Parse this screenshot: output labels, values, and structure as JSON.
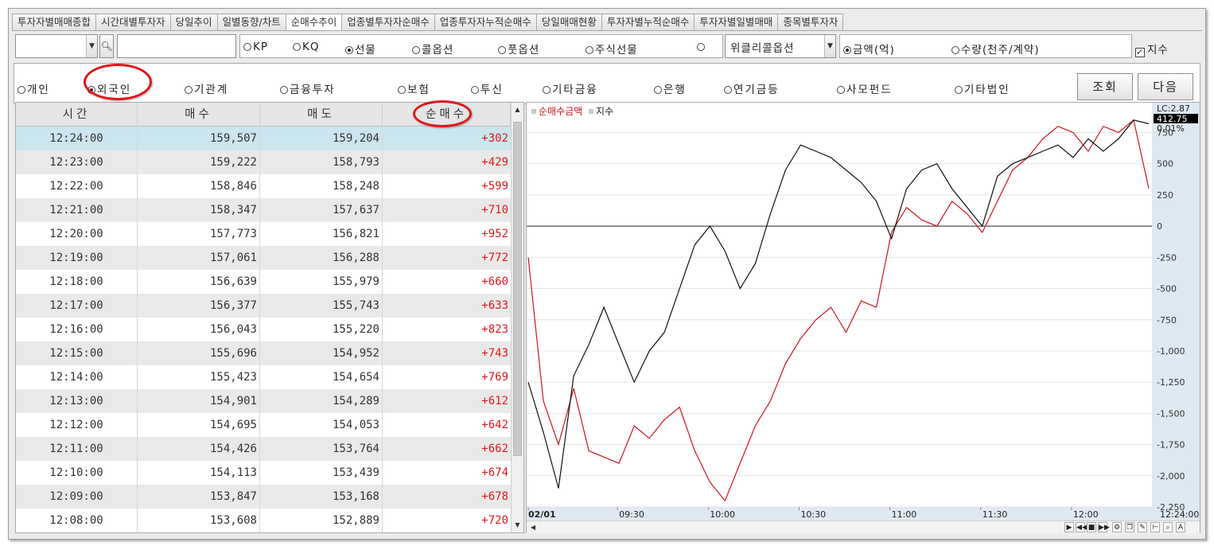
{
  "tabs": [
    "투자자별매매종합",
    "시간대별투자자",
    "당일추이",
    "일별동향/차트",
    "순매수추이",
    "업종별투자자순매수",
    "업종투자자누적순매수",
    "당일매매현황",
    "투자자별누적순매수",
    "투자자별일별매매",
    "종목별투자자"
  ],
  "active_tab": 4,
  "row1": {
    "markets": [
      {
        "label": "KP",
        "selected": false
      },
      {
        "label": "KQ",
        "selected": false
      },
      {
        "label": "선물",
        "selected": true
      },
      {
        "label": "콜옵션",
        "selected": false
      },
      {
        "label": "풋옵션",
        "selected": false
      },
      {
        "label": "주식선물",
        "selected": false
      },
      {
        "label": "",
        "selected": false
      }
    ],
    "weekly_option": "위클리콜옵션",
    "units": [
      {
        "label": "금액(억)",
        "selected": true
      },
      {
        "label": "수량(천주/계약)",
        "selected": false
      }
    ],
    "index_checkbox": {
      "label": "지수",
      "checked": true
    }
  },
  "investors": [
    {
      "label": "개인",
      "selected": false
    },
    {
      "label": "외국인",
      "selected": true
    },
    {
      "label": "기관계",
      "selected": false
    },
    {
      "label": "금융투자",
      "selected": false
    },
    {
      "label": "보험",
      "selected": false
    },
    {
      "label": "투신",
      "selected": false
    },
    {
      "label": "기타금융",
      "selected": false
    },
    {
      "label": "은행",
      "selected": false
    },
    {
      "label": "연기금등",
      "selected": false
    },
    {
      "label": "사모펀드",
      "selected": false
    },
    {
      "label": "기타법인",
      "selected": false
    }
  ],
  "buttons": {
    "query": "조회",
    "next": "다음"
  },
  "table": {
    "headers": [
      "시간",
      "매수",
      "매도",
      "순매수"
    ],
    "rows": [
      [
        "12:24:00",
        "159,507",
        "159,204",
        "+302"
      ],
      [
        "12:23:00",
        "159,222",
        "158,793",
        "+429"
      ],
      [
        "12:22:00",
        "158,846",
        "158,248",
        "+599"
      ],
      [
        "12:21:00",
        "158,347",
        "157,637",
        "+710"
      ],
      [
        "12:20:00",
        "157,773",
        "156,821",
        "+952"
      ],
      [
        "12:19:00",
        "157,061",
        "156,288",
        "+772"
      ],
      [
        "12:18:00",
        "156,639",
        "155,979",
        "+660"
      ],
      [
        "12:17:00",
        "156,377",
        "155,743",
        "+633"
      ],
      [
        "12:16:00",
        "156,043",
        "155,220",
        "+823"
      ],
      [
        "12:15:00",
        "155,696",
        "154,952",
        "+743"
      ],
      [
        "12:14:00",
        "155,423",
        "154,654",
        "+769"
      ],
      [
        "12:13:00",
        "154,901",
        "154,289",
        "+612"
      ],
      [
        "12:12:00",
        "154,695",
        "154,053",
        "+642"
      ],
      [
        "12:11:00",
        "154,426",
        "153,764",
        "+662"
      ],
      [
        "12:10:00",
        "154,113",
        "153,439",
        "+674"
      ],
      [
        "12:09:00",
        "153,847",
        "153,168",
        "+678"
      ],
      [
        "12:08:00",
        "153,608",
        "152,889",
        "+720"
      ]
    ]
  },
  "chart": {
    "legend": [
      "순매수금액",
      "지수"
    ],
    "lc_label": "LC:2.87",
    "index_value": "412.75",
    "pct_label": "0.01%",
    "y_ticks": [
      "750",
      "500",
      "250",
      "0",
      "-250",
      "-500",
      "-750",
      "-1,000",
      "-1,250",
      "-1,500",
      "-1,750",
      "-2,000",
      "-2,250"
    ],
    "x_ticks": [
      "02/01",
      "09:30",
      "10:00",
      "10:30",
      "11:00",
      "11:30",
      "12:00",
      "12:24:00"
    ],
    "colors": {
      "net_buy": "#d0141c",
      "index": "#111111"
    }
  },
  "chart_data": {
    "type": "line",
    "ylim": [
      -2250,
      900
    ],
    "x": [
      "09:00",
      "09:05",
      "09:10",
      "09:15",
      "09:20",
      "09:25",
      "09:30",
      "09:35",
      "09:40",
      "09:45",
      "09:50",
      "09:55",
      "10:00",
      "10:05",
      "10:10",
      "10:15",
      "10:20",
      "10:25",
      "10:30",
      "10:35",
      "10:40",
      "10:45",
      "10:50",
      "10:55",
      "11:00",
      "11:05",
      "11:10",
      "11:15",
      "11:20",
      "11:25",
      "11:30",
      "11:35",
      "11:40",
      "11:45",
      "11:50",
      "11:55",
      "12:00",
      "12:05",
      "12:10",
      "12:15",
      "12:20",
      "12:24"
    ],
    "series": [
      {
        "name": "순매수금액",
        "values": [
          -250,
          -1400,
          -1750,
          -1300,
          -1800,
          -1850,
          -1900,
          -1600,
          -1700,
          -1550,
          -1450,
          -1800,
          -2050,
          -2200,
          -1900,
          -1600,
          -1400,
          -1100,
          -900,
          -750,
          -650,
          -850,
          -600,
          -650,
          -50,
          150,
          50,
          0,
          200,
          100,
          -50,
          200,
          450,
          550,
          700,
          800,
          750,
          600,
          800,
          750,
          850,
          302
        ]
      },
      {
        "name": "지수",
        "values": [
          -1250,
          -1650,
          -2100,
          -1200,
          -950,
          -650,
          -950,
          -1250,
          -1000,
          -850,
          -500,
          -150,
          0,
          -200,
          -500,
          -300,
          100,
          450,
          650,
          600,
          550,
          450,
          350,
          200,
          -100,
          300,
          450,
          500,
          300,
          150,
          0,
          400,
          500,
          550,
          600,
          650,
          550,
          700,
          600,
          700,
          850,
          820
        ]
      }
    ]
  }
}
